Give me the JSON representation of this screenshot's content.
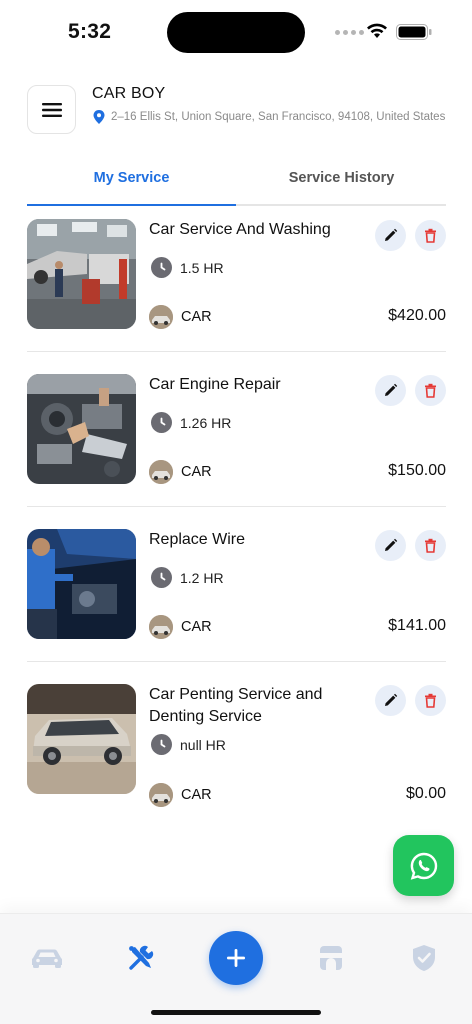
{
  "status": {
    "time": "5:32"
  },
  "header": {
    "title": "CAR BOY",
    "address": "2–16 Ellis St, Union Square, San Francisco, 94108, United States"
  },
  "tabs": [
    {
      "label": "My Service",
      "active": true
    },
    {
      "label": "Service History",
      "active": false
    }
  ],
  "services": [
    {
      "name": "Car Service And Washing",
      "duration": "1.5 HR",
      "category": "CAR",
      "price": "$420.00",
      "image": "garage-photo"
    },
    {
      "name": "Car Engine Repair",
      "duration": "1.26 HR",
      "category": "CAR",
      "price": "$150.00",
      "image": "engine-photo"
    },
    {
      "name": "Replace Wire",
      "duration": "1.2 HR",
      "category": "CAR",
      "price": "$141.00",
      "image": "mechanic-photo"
    },
    {
      "name": "Car Penting Service and Denting Service",
      "duration": "null HR",
      "category": "CAR",
      "price": "$0.00",
      "image": "suv-photo"
    }
  ],
  "bottom_nav": [
    {
      "icon": "car-icon",
      "active": false
    },
    {
      "icon": "tools-icon",
      "active": true
    },
    {
      "icon": "plus-icon",
      "active": false
    },
    {
      "icon": "store-icon",
      "active": false
    },
    {
      "icon": "shield-check-icon",
      "active": false
    }
  ],
  "colors": {
    "accent": "#1f6fe0",
    "whatsapp": "#22c55e",
    "delete": "#e53935"
  }
}
